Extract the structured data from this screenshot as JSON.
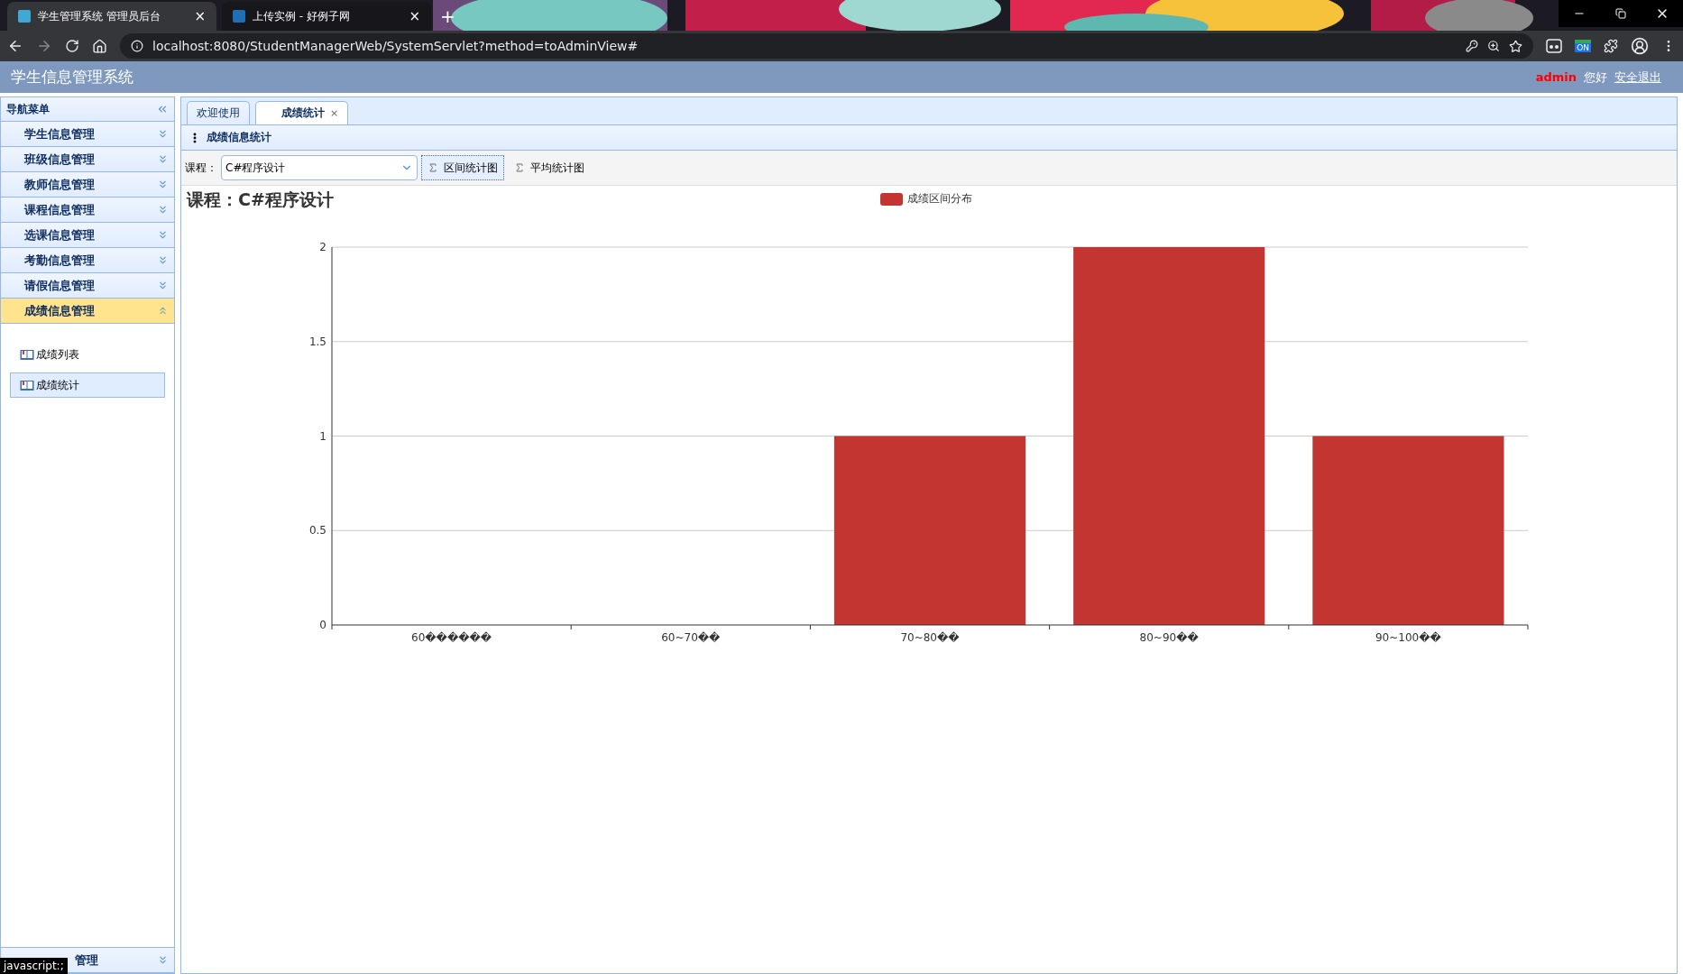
{
  "browser": {
    "tabs": [
      {
        "title": "学生管理系统 管理员后台",
        "selected": true,
        "close": "×"
      },
      {
        "title": "上传实例 - 好例子网",
        "selected": false,
        "close": "×"
      }
    ],
    "new_tab": "+",
    "address": "localhost:8080/StudentManagerWeb/SystemServlet?method=toAdminView#",
    "extension_badge": "ON"
  },
  "header": {
    "title": "学生信息管理系统",
    "user": "admin",
    "greeting": "您好",
    "logout": "安全退出"
  },
  "sidebar": {
    "title": "导航菜单",
    "items": [
      {
        "label": "学生信息管理",
        "expanded": false
      },
      {
        "label": "班级信息管理",
        "expanded": false
      },
      {
        "label": "教师信息管理",
        "expanded": false
      },
      {
        "label": "课程信息管理",
        "expanded": false
      },
      {
        "label": "选课信息管理",
        "expanded": false
      },
      {
        "label": "考勤信息管理",
        "expanded": false
      },
      {
        "label": "请假信息管理",
        "expanded": false
      },
      {
        "label": "成绩信息管理",
        "expanded": true,
        "children": [
          {
            "label": "成绩列表",
            "selected": false
          },
          {
            "label": "成绩统计",
            "selected": true
          }
        ]
      },
      {
        "label": "管理",
        "expanded": false
      }
    ]
  },
  "tabs": [
    {
      "label": "欢迎使用",
      "selected": false
    },
    {
      "label": "成绩统计",
      "selected": true,
      "close": "×"
    }
  ],
  "panel": {
    "title": "成绩信息统计",
    "filter_label": "课程：",
    "course": "C#程序设计",
    "buttons": [
      {
        "label": "区间统计图",
        "selected": true
      },
      {
        "label": "平均统计图",
        "selected": false
      }
    ],
    "chart_data": {
      "type": "bar",
      "title": "课程：C#程序设计",
      "categories": [
        "60������",
        "60~70��",
        "70~80��",
        "80~90��",
        "90~100��"
      ],
      "series": [
        {
          "name": "成绩区间分布",
          "color": "#c23531",
          "values": [
            0,
            0,
            1,
            2,
            1
          ]
        }
      ],
      "ylim": [
        0,
        2
      ],
      "grid": true,
      "yticks": [
        0,
        0.5,
        1,
        1.5,
        2
      ]
    }
  },
  "status_text": "javascript:;"
}
